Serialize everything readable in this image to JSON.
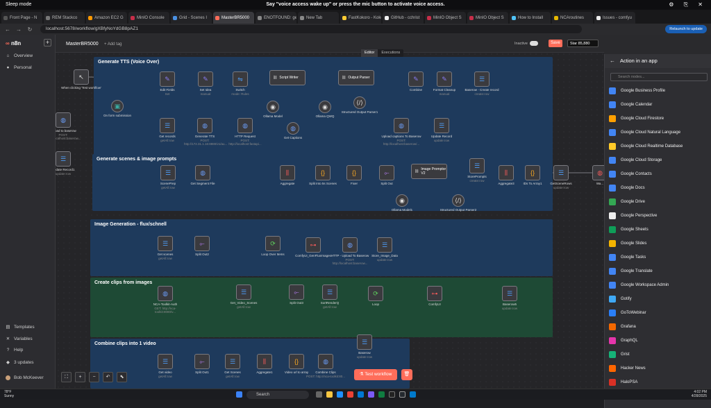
{
  "os": {
    "mode": "Sleep mode",
    "banner": "Say \"voice access wake up\" or press the mic button to activate voice access.",
    "ctrl": "⚙ ⎘ ✕"
  },
  "tabs": [
    {
      "label": "Front Page - N",
      "color": "#555"
    },
    {
      "label": "REM Stackco",
      "color": "#777"
    },
    {
      "label": "Amazon EC2 G",
      "color": "#ff9900"
    },
    {
      "label": "MinIO Console",
      "color": "#c72e49"
    },
    {
      "label": "Grid - Scenes I",
      "color": "#4a90e2"
    },
    {
      "label": "MasterBR5000",
      "color": "#ff6d5a"
    },
    {
      "label": "ENOTFOUND: ge",
      "color": "#888"
    },
    {
      "label": "New Tab",
      "color": "#888"
    },
    {
      "label": "FastKokoro - Kokc",
      "color": "#ffcc33"
    },
    {
      "label": "GitHub - cchrist",
      "color": "#eee"
    },
    {
      "label": "MinIO Object S",
      "color": "#c72e49"
    },
    {
      "label": "MinIO Object S",
      "color": "#c72e49"
    },
    {
      "label": "How to Install",
      "color": "#4fc3f7"
    },
    {
      "label": "NCAroutines",
      "color": "#e6b800"
    },
    {
      "label": "Issues - comfyu",
      "color": "#eee"
    }
  ],
  "address": {
    "url": "localhost:5678/workflow/gXBfyNoYdGB8pAZ1",
    "back": "←",
    "fwd": "→",
    "reload": "↻",
    "relaunch": "Relaunch to update"
  },
  "sidebar": {
    "logo": "n8n",
    "plus": "+",
    "overview": "Overview",
    "personal": "Personal",
    "templates": "Templates",
    "variables": "Variables",
    "help": "Help",
    "updates": "3 updates",
    "user": "Bob McKeever",
    "icons": {
      "overview": "⌂",
      "personal": "●",
      "templates": "▤",
      "variables": "✕",
      "help": "?",
      "updates": "◆"
    }
  },
  "header": {
    "workflow_name": "MasterBR5000",
    "add_tag": "+ Add tag",
    "inactive": "Inactive",
    "save": "Save",
    "star": "Star 85,880",
    "editor": "Editor",
    "executions": "Executions"
  },
  "groups": [
    {
      "title": "Generate TTS (Voice Over)"
    },
    {
      "title": "Generate scenes & image prompts"
    },
    {
      "title": "Image Generation - flux/schnell"
    },
    {
      "title": "Create clips from images"
    },
    {
      "title": "Combine clips into 1 video"
    }
  ],
  "nodes": [
    {
      "name": "When clicking 'Test workflow'",
      "sub": "",
      "icon": "↖",
      "color": "#ddd"
    },
    {
      "name": "On form submission",
      "sub": "",
      "icon": "▣",
      "color": "#3aa9a0"
    },
    {
      "name": "Edit Fields",
      "sub": "Set",
      "icon": "✎",
      "color": "#8a7cf5"
    },
    {
      "name": "Set Idea",
      "sub": "manual",
      "icon": "✎",
      "color": "#8a7cf5"
    },
    {
      "name": "Switch",
      "sub": "mode: Rules",
      "icon": "⇋",
      "color": "#4d9cf5"
    },
    {
      "name": "Script Writer",
      "sub": "",
      "icon": "⛓",
      "color": "#ddd"
    },
    {
      "name": "Output Parser",
      "sub": "",
      "icon": "⛓",
      "color": "#ddd"
    },
    {
      "name": "Combine",
      "sub": "",
      "icon": "✎",
      "color": "#8a7cf5"
    },
    {
      "name": "Format Cleanup",
      "sub": "manual",
      "icon": "✎",
      "color": "#8a7cf5"
    },
    {
      "name": "Baserow - Create record",
      "sub": "create:row",
      "icon": "☰",
      "color": "#4d9cf5"
    },
    {
      "name": "Ollama Model",
      "sub": "",
      "icon": "◉",
      "color": "#ddd"
    },
    {
      "name": "Ollama QWQ",
      "sub": "",
      "icon": "◉",
      "color": "#ddd"
    },
    {
      "name": "Structured Output Parser1",
      "sub": "",
      "icon": "⟨/⟩",
      "color": "#ddd"
    },
    {
      "name": "Get records",
      "sub": "getAll:row",
      "icon": "☰",
      "color": "#4d9cf5"
    },
    {
      "name": "Generate TTS",
      "sub": "POST: http://172.31.1.16:8880/v1/au...",
      "icon": "◍",
      "color": "#6a9cf5"
    },
    {
      "name": "HTTP Request",
      "sub": "POST: http://localhost:fastapi...",
      "icon": "◍",
      "color": "#6a9cf5"
    },
    {
      "name": "Get Captions",
      "sub": "",
      "icon": "◍",
      "color": "#6a9cf5"
    },
    {
      "name": "Upload captions To Baserow",
      "sub": "POST: http://localhost:baserow/...",
      "icon": "◍",
      "color": "#6a9cf5"
    },
    {
      "name": "Update Record",
      "sub": "update:row",
      "icon": "☰",
      "color": "#4d9cf5"
    },
    {
      "name": "ScenePrep",
      "sub": "getAll:row",
      "icon": "☰",
      "color": "#4d9cf5"
    },
    {
      "name": "Get Segment File",
      "sub": "",
      "icon": "◍",
      "color": "#6a9cf5"
    },
    {
      "name": "Aggregate",
      "sub": "",
      "icon": "⫼",
      "color": "#f05a5a"
    },
    {
      "name": "Split Into 5s Scenes",
      "sub": "",
      "icon": "{}",
      "color": "#f5a623"
    },
    {
      "name": "Fixer",
      "sub": "",
      "icon": "{}",
      "color": "#f5a623"
    },
    {
      "name": "Split Out",
      "sub": "",
      "icon": "⟜",
      "color": "#b57cf5"
    },
    {
      "name": "Image Promptor V2",
      "sub": "",
      "icon": "⛓",
      "color": "#ddd"
    },
    {
      "name": "StorePrompts",
      "sub": "create:row",
      "icon": "☰",
      "color": "#4d9cf5"
    },
    {
      "name": "Aggregate3",
      "sub": "",
      "icon": "⫼",
      "color": "#f05a5a"
    },
    {
      "name": "IDs To Array1",
      "sub": "",
      "icon": "{}",
      "color": "#f5a623"
    },
    {
      "name": "GetSceneRows",
      "sub": "update:row",
      "icon": "☰",
      "color": "#4d9cf5"
    },
    {
      "name": "Wa...",
      "sub": "",
      "icon": "◍",
      "color": "#f05a5a"
    },
    {
      "name": "Ollama Model1",
      "sub": "",
      "icon": "◉",
      "color": "#ddd"
    },
    {
      "name": "Structured Output Parser2",
      "sub": "",
      "icon": "⟨/⟩",
      "color": "#ddd"
    },
    {
      "name": "Get scenes",
      "sub": "getAll:row",
      "icon": "☰",
      "color": "#4d9cf5"
    },
    {
      "name": "Split Out2",
      "sub": "",
      "icon": "⟜",
      "color": "#b57cf5"
    },
    {
      "name": "Loop Over Items",
      "sub": "",
      "icon": "⟳",
      "color": "#5fd35f"
    },
    {
      "name": "ComfyUI_GenFluxImages",
      "sub": "",
      "icon": "⊶",
      "color": "#f05a5a"
    },
    {
      "name": "HTTP - Upload To Baserow",
      "sub": "POST: http://localhost:baserow...",
      "icon": "◍",
      "color": "#6a9cf5"
    },
    {
      "name": "Store_Image_Data",
      "sub": "update:row",
      "icon": "☰",
      "color": "#4d9cf5"
    },
    {
      "name": "NCA-Toolkit-Auth",
      "sub": "GET: http://nca-toolkit:8080/v...",
      "icon": "◍",
      "color": "#6a9cf5"
    },
    {
      "name": "Get_Video_Scenes",
      "sub": "getAll:row",
      "icon": "☰",
      "color": "#4d9cf5"
    },
    {
      "name": "Split Out3",
      "sub": "",
      "icon": "⟜",
      "color": "#b57cf5"
    },
    {
      "name": "SortRenderQ",
      "sub": "getAll:row",
      "icon": "☰",
      "color": "#4d9cf5"
    },
    {
      "name": "Loop",
      "sub": "",
      "icon": "⟳",
      "color": "#5fd35f"
    },
    {
      "name": "ComfyUI",
      "sub": "",
      "icon": "⊶",
      "color": "#f05a5a"
    },
    {
      "name": "Baserow5",
      "sub": "update:row",
      "icon": "☰",
      "color": "#4d9cf5"
    },
    {
      "name": "Get video",
      "sub": "getAll:row",
      "icon": "☰",
      "color": "#4d9cf5"
    },
    {
      "name": "Split Out1",
      "sub": "",
      "icon": "⟜",
      "color": "#b57cf5"
    },
    {
      "name": "Get Scenes",
      "sub": "getAll:row",
      "icon": "☰",
      "color": "#4d9cf5"
    },
    {
      "name": "Aggregate1",
      "sub": "",
      "icon": "⫼",
      "color": "#f05a5a"
    },
    {
      "name": "Video url to array",
      "sub": "",
      "icon": "{}",
      "color": "#f5a623"
    },
    {
      "name": "Combine Clips",
      "sub": "POST: http://nca-toolkit:80...",
      "icon": "◍",
      "color": "#6a9cf5"
    },
    {
      "name": "Baserow",
      "sub": "update:row",
      "icon": "☰",
      "color": "#4d9cf5"
    },
    {
      "name": "Upload to baserow",
      "sub": "POST: http://localhost:baserow...",
      "icon": "◍",
      "color": "#6a9cf5"
    },
    {
      "name": "Update Record1",
      "sub": "update:row",
      "icon": "☰",
      "color": "#4d9cf5"
    }
  ],
  "edge_labels": {
    "item": "1 item",
    "short": "Short Script",
    "long": "Long Script"
  },
  "controls": {
    "fit": "⛶",
    "zoomin": "+",
    "zoomout": "−",
    "undo": "↶",
    "tidy": "⬉",
    "test": "⚗ Test workflow",
    "trash": "🗑"
  },
  "panel": {
    "title": "Action in an app",
    "back": "←",
    "search_placeholder": "Search nodes...",
    "items": [
      {
        "label": "Google Business Profile",
        "color": "#4285f4"
      },
      {
        "label": "Google Calendar",
        "color": "#4285f4"
      },
      {
        "label": "Google Cloud Firestore",
        "color": "#ffa000"
      },
      {
        "label": "Google Cloud Natural Language",
        "color": "#4285f4"
      },
      {
        "label": "Google Cloud Realtime Database",
        "color": "#ffca28"
      },
      {
        "label": "Google Cloud Storage",
        "color": "#4285f4"
      },
      {
        "label": "Google Contacts",
        "color": "#4285f4"
      },
      {
        "label": "Google Docs",
        "color": "#4285f4"
      },
      {
        "label": "Google Drive",
        "color": "#34a853"
      },
      {
        "label": "Google Perspective",
        "color": "#eeeeee"
      },
      {
        "label": "Google Sheets",
        "color": "#0f9d58"
      },
      {
        "label": "Google Slides",
        "color": "#f4b400"
      },
      {
        "label": "Google Tasks",
        "color": "#4285f4"
      },
      {
        "label": "Google Translate",
        "color": "#4285f4"
      },
      {
        "label": "Google Workspace Admin",
        "color": "#4285f4"
      },
      {
        "label": "Gotify",
        "color": "#3fa9f5"
      },
      {
        "label": "GoToWebinar",
        "color": "#2a7ff8"
      },
      {
        "label": "Grafana",
        "color": "#f46800"
      },
      {
        "label": "GraphQL",
        "color": "#e535ab"
      },
      {
        "label": "Grist",
        "color": "#16b378"
      },
      {
        "label": "Hacker News",
        "color": "#ff6600"
      },
      {
        "label": "HaloPSA",
        "color": "#d93025"
      }
    ]
  },
  "taskbar": {
    "temp": "78°F",
    "cond": "Sunny",
    "search": "Search",
    "time": "4:02 PM",
    "date": "4/28/2025"
  }
}
